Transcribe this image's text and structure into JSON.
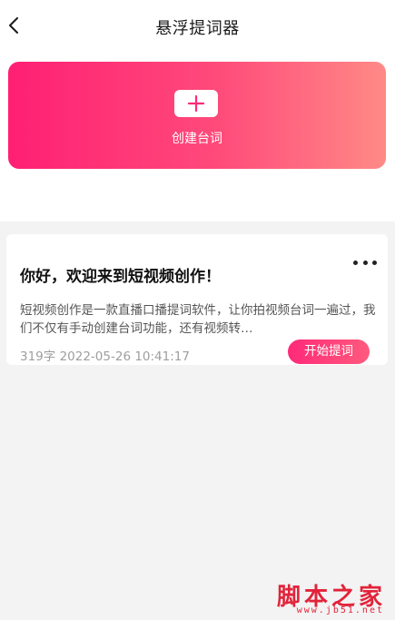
{
  "header": {
    "back_icon": "chevron-left-icon",
    "title": "悬浮提词器"
  },
  "create_banner": {
    "icon": "plus-icon",
    "label": "创建台词",
    "gradient_start": "#ff1f74",
    "gradient_end": "#ff8a86"
  },
  "scripts": [
    {
      "title": "你好，欢迎来到短视频创作！",
      "description": "短视频创作是一款直播口播提词软件，让你拍视频台词一遍过，我们不仅有手动创建台词功能，还有视频转…",
      "word_count": "319字",
      "timestamp": "2022-05-26 10:41:17",
      "more_icon": "more-horizontal-icon",
      "start_label": "开始提词"
    }
  ],
  "watermark": {
    "text": "脚本之家",
    "sub": "www.jb51.net"
  },
  "colors": {
    "accent": "#ff2a78",
    "list_background": "#f3f3f3"
  }
}
